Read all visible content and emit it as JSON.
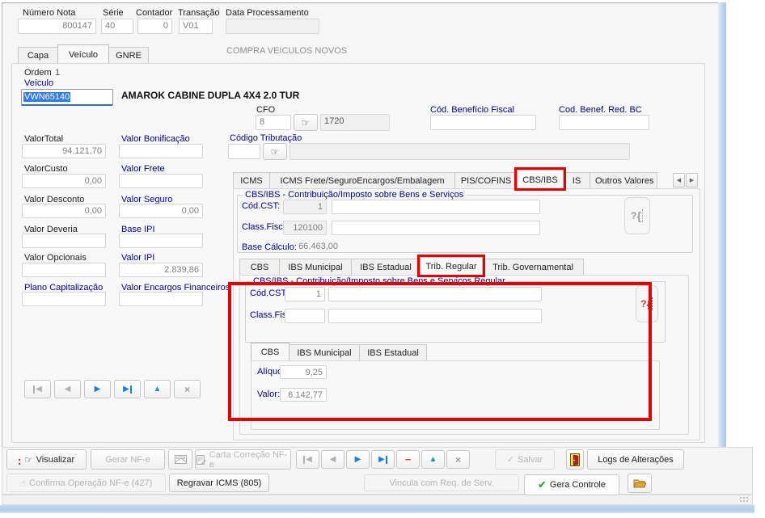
{
  "colors": {
    "annotation": "#e60000",
    "navy_label": "#00009b",
    "selection_blue": "#2e7bf0",
    "nav_enabled_blue": "#1a7de0",
    "nav_up_teal": "#1899ad",
    "nav_remove_red": "#e2402f",
    "confirm_green": "#21a121"
  },
  "icons": {
    "hand_pointer": "☞",
    "confirm_hand": "☝",
    "check": "✓",
    "check_bold": "✔",
    "nav_prev": "◀",
    "nav_next": "▶",
    "nav_up": "▲",
    "nav_remove": "−",
    "nav_close": "×",
    "scroll_left": "◀",
    "scroll_right": "▶"
  },
  "help_icon": {
    "q": "?",
    "brace": "{"
  },
  "header": {
    "fields": [
      {
        "label": "Número Nota",
        "value": "800147"
      },
      {
        "label": "Série",
        "value": "40"
      },
      {
        "label": "Contador",
        "value": "0"
      },
      {
        "label": "Transação",
        "value": "V01"
      },
      {
        "label": "Data Processamento",
        "value": ""
      }
    ]
  },
  "main_tabs": [
    "Capa",
    "Veículo",
    "GNRE"
  ],
  "transaction_desc": "COMPRA VEICULOS NOVOS",
  "vehicle": {
    "ordem_label": "Ordem",
    "ordem_value": "1",
    "veiculo_label": "Veículo",
    "plate": "VWN65140",
    "model": "AMAROK CABINE DUPLA 4X4 2.0 TUR",
    "cfo_label": "CFO",
    "cfo_code": "8",
    "cfo_desc": "1720",
    "benef_label": "Cód. Benefício Fiscal",
    "benef_value": "",
    "benef_red_label": "Cod. Benef. Red. BC",
    "benef_red_value": "",
    "cod_trib_label": "Código Tributação",
    "cod_trib_value": "",
    "cod_trib_desc": ""
  },
  "amounts": {
    "col1": [
      {
        "label": "ValorTotal",
        "value": "94.121,70"
      },
      {
        "label": "ValorCusto",
        "value": "0,00"
      },
      {
        "label": "Valor Desconto",
        "value": "0,00"
      },
      {
        "label": "Valor Deveria",
        "value": ""
      },
      {
        "label": "Valor Opcionais",
        "value": ""
      },
      {
        "label": "Plano Capitalização",
        "value": ""
      }
    ],
    "col2": [
      {
        "label": "Valor Bonificação",
        "value": ""
      },
      {
        "label": "Valor Frete",
        "value": ""
      },
      {
        "label": "Valor Seguro",
        "value": "0,00"
      },
      {
        "label": "Base IPI",
        "value": ""
      },
      {
        "label": "Valor IPI",
        "value": "2.839,86"
      },
      {
        "label": "Valor Encargos Financeiros",
        "value": ""
      }
    ]
  },
  "tax_tabs": [
    "ICMS",
    "ICMS Frete/SeguroEncargos/Embalagem",
    "PIS/COFINS",
    "CBS/IBS",
    "IS",
    "Outros Valores"
  ],
  "cbs_section": {
    "title": "CBS/IBS -  Contribuição/Imposto sobre Bens e Serviços",
    "cst_label": "Cód.CST:",
    "cst_value": "1",
    "cst_desc": "",
    "cf_label": "Class.Fiscal:",
    "cf_value": "120100",
    "cf_desc": "",
    "bc_label": "Base Cálculo:",
    "bc_value": "66.463,00"
  },
  "sub_tabs": [
    "CBS",
    "IBS Municipal",
    "IBS Estadual",
    "Trib. Regular",
    "Trib. Governamental"
  ],
  "regular_section": {
    "title": "CBS/IBS -  Contribuição/Imposto sobre Bens e Serviços Regular",
    "cst_label": "Cód.CST:",
    "cst_value": "1",
    "cst_desc": "",
    "cf_label": "Class.Fiscal:",
    "cf_value": "",
    "cf_desc": ""
  },
  "inner_tabs": [
    "CBS",
    "IBS Municipal",
    "IBS Estadual"
  ],
  "inner_fields": {
    "aliquota_label": "Alíquota:",
    "aliquota_value": "9,25",
    "valor_label": "Valor:",
    "valor_value": "6.142,77"
  },
  "toolbar": {
    "visualizar": "Visualizar",
    "gerar_nfe": "Gerar NF-e",
    "carta": "Carta Correção NF-e",
    "salvar": "Salvar",
    "logs": "Logs de Alterações",
    "confirma": "Confirma Operação NF-e (427)",
    "regravar": "Regravar ICMS (805)",
    "vincula": "Vincula com Req. de Serv.",
    "gera_controle": "Gera Controle"
  }
}
